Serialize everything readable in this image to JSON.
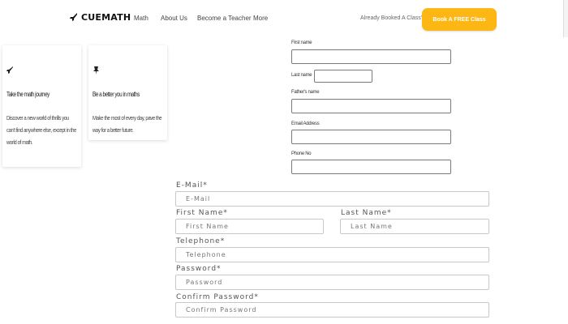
{
  "header": {
    "logo": "CUEMATH",
    "nav": [
      "Math",
      "About Us",
      "Become a Teacher",
      "More"
    ],
    "booked_text": "Already Booked A Class?",
    "cta": "Book A FREE Class"
  },
  "cards": [
    {
      "icon": "rocket-icon",
      "title": "Take the math journey",
      "desc": "Discover a new world of thrills you can't find anywhere else, except in the world of math."
    },
    {
      "icon": "pin-icon",
      "title": "Be a better you in maths",
      "desc": "Make the most of every day, pave the way for a better future."
    }
  ],
  "small_form": {
    "first_name_label": "First name",
    "last_name_label": "Last name",
    "fathers_name_label": "Father's name",
    "email_label": "Email Address",
    "phone_label": "Phone No"
  },
  "big_form": {
    "email_label": "E-Mail*",
    "email_placeholder": "E-Mail",
    "first_name_label": "First Name*",
    "first_name_placeholder": "First Name",
    "last_name_label": "Last Name*",
    "last_name_placeholder": "Last Name",
    "telephone_label": "Telephone*",
    "telephone_placeholder": "Telephone",
    "password_label": "Password*",
    "password_placeholder": "Password",
    "confirm_label": "Confirm Password*",
    "confirm_placeholder": "Confirm Password"
  },
  "colors": {
    "accent": "#fdb714",
    "input_border": "#c8c8c8"
  }
}
